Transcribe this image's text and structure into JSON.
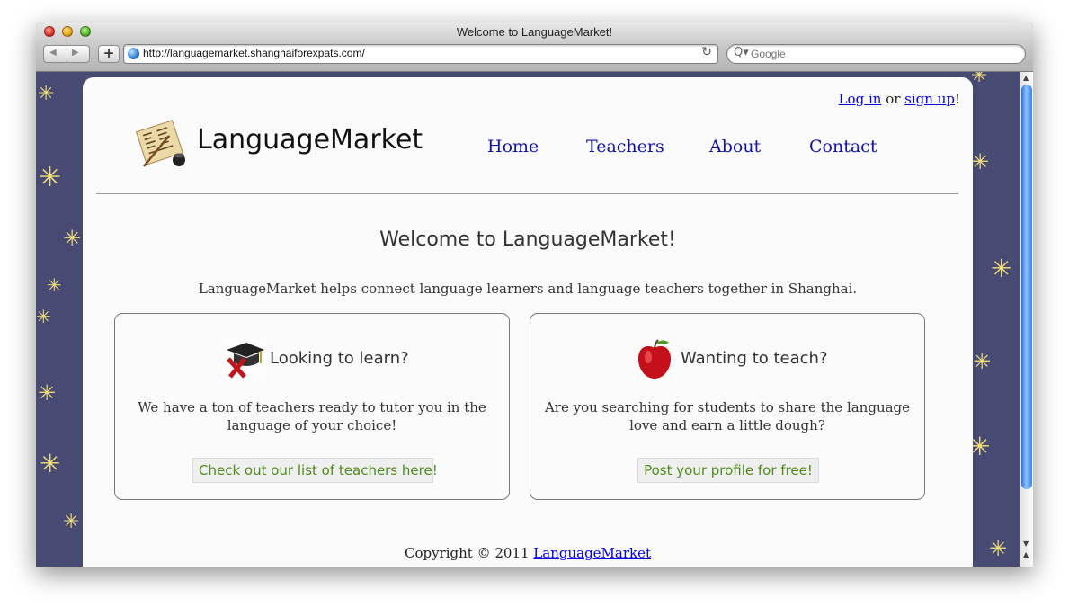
{
  "browser": {
    "window_title": "Welcome to LanguageMarket!",
    "url": "http://languagemarket.shanghaiforexpats.com/",
    "search_placeholder": "Google",
    "back_glyph": "◀",
    "forward_glyph": "▶",
    "add_glyph": "+",
    "reload_glyph": "↻",
    "search_glyph": "Q▾"
  },
  "header": {
    "auth_login": "Log in",
    "auth_or": " or ",
    "auth_signup": "sign up",
    "auth_end": "!",
    "logo_text": "LanguageMarket",
    "nav": [
      "Home",
      "Teachers",
      "About",
      "Contact"
    ]
  },
  "main": {
    "welcome": "Welcome to LanguageMarket!",
    "tagline": "LanguageMarket helps connect language learners and language teachers together in Shanghai.",
    "learn": {
      "title": "Looking to learn?",
      "text": "We have a ton of teachers ready to tutor you in the language of your choice!",
      "button": "Check out our list of teachers here!"
    },
    "teach": {
      "title": "Wanting to teach?",
      "text": "Are you searching for students to share the language love and earn a little dough?",
      "button": "Post your profile for free!"
    }
  },
  "footer": {
    "copyright": "Copyright © 2011 ",
    "link": "LanguageMarket"
  },
  "colors": {
    "background": "#474a73",
    "star": "#f5e07a",
    "nav_link": "#1212a8",
    "button_text": "#4e8b1c"
  }
}
